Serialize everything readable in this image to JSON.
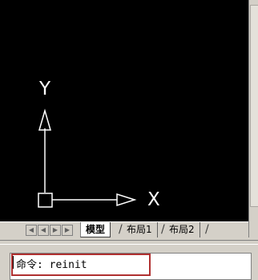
{
  "ucs_icon": {
    "x_label": "X",
    "y_label": "Y"
  },
  "layout_tabs": {
    "nav_buttons": [
      "first-tab",
      "previous-tab",
      "next-tab",
      "last-tab"
    ],
    "tabs": [
      {
        "label": "模型",
        "active": true
      },
      {
        "label": "布局1",
        "active": false
      },
      {
        "label": "布局2",
        "active": false
      }
    ]
  },
  "command_line": {
    "text": "命令: reinit"
  },
  "colors": {
    "drawing_background": "#000000",
    "ucs_color": "#ffffff",
    "highlight_border": "#b03030"
  }
}
